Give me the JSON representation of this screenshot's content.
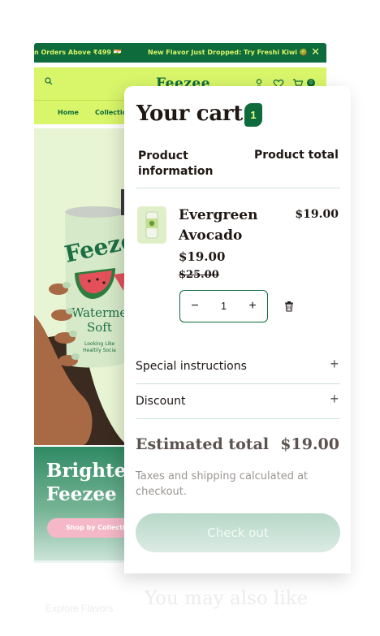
{
  "announcement": {
    "left_text": "n Orders Above ₹499 🇮🇳",
    "center_text": "New Flavor Just Dropped: Try Freshi Kiwi 🥝",
    "close_glyph": "✕"
  },
  "header": {
    "logo": "Feezee",
    "cart_count_badge": "0",
    "icons": [
      "search-icon",
      "account-icon",
      "heart-icon",
      "cart-icon"
    ]
  },
  "nav": {
    "items": [
      {
        "label": "Home"
      },
      {
        "label": "Collection"
      }
    ]
  },
  "hero": {
    "can_brand": "Feezee",
    "can_flavor_line1": "Watermelo",
    "can_flavor_line2": "Soft",
    "can_tagline_line1": "Looking Like",
    "can_tagline_line2": "Healtily Socia"
  },
  "promo": {
    "title": "Brighter\nFeezee",
    "button_label": "Shop by Collection"
  },
  "cart": {
    "title": "Your cart",
    "count": "1",
    "col_product": "Product information",
    "col_total": "Product total",
    "item": {
      "name": "Evergreen Avocado",
      "price": "$19.00",
      "compare_price": "$25.00",
      "line_total": "$19.00",
      "quantity": "1",
      "minus_glyph": "−",
      "plus_glyph": "+"
    },
    "special_instructions": "Special instructions",
    "discount": "Discount",
    "expand_glyph": "+",
    "estimated_total_label": "Estimated total",
    "estimated_total_value": "$19.00",
    "tax_note": "Taxes and shipping calculated at checkout.",
    "checkout_label": "Check out"
  },
  "below": {
    "link_text": "Explore Flavors",
    "recommendations_title": "You may also like"
  },
  "colors": {
    "brand_green": "#0e6b3c",
    "lime": "#d9f56a",
    "hero_bg": "#e8f5d4",
    "checkout_gradient_top": "#b7d8c9"
  }
}
